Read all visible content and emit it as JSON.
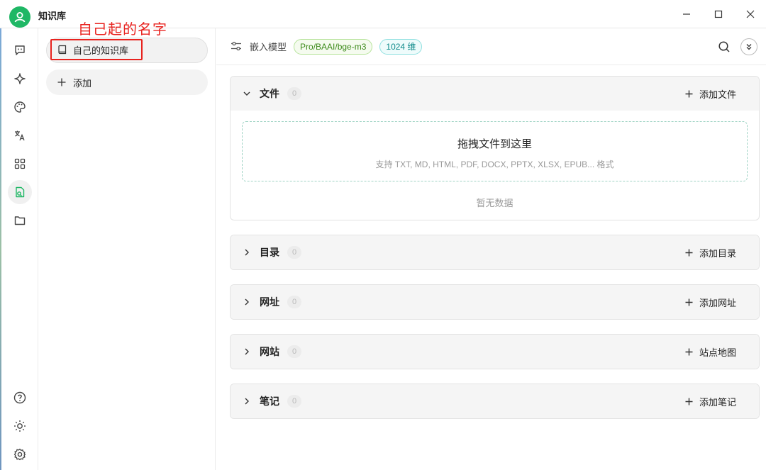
{
  "app": {
    "title": "知识库"
  },
  "annotation": {
    "text": "自己起的名字",
    "color": "#e8231f"
  },
  "rail": {
    "items": [
      {
        "name": "chat-icon"
      },
      {
        "name": "sparkle-icon"
      },
      {
        "name": "palette-icon"
      },
      {
        "name": "translate-icon"
      },
      {
        "name": "apps-icon"
      },
      {
        "name": "knowledge-icon",
        "active": true
      },
      {
        "name": "folder-icon"
      }
    ],
    "bottom": [
      {
        "name": "help-icon"
      },
      {
        "name": "theme-icon"
      },
      {
        "name": "settings-icon"
      }
    ]
  },
  "kb_list": {
    "items": [
      {
        "label": "自己的知识库"
      }
    ],
    "add_label": "添加"
  },
  "header": {
    "embedding_label": "嵌入模型",
    "model_badge": "Pro/BAAI/bge-m3",
    "dim_badge": "1024 维"
  },
  "sections": [
    {
      "title": "文件",
      "count": "0",
      "action": "添加文件",
      "expanded": true,
      "dropzone_title": "拖拽文件到这里",
      "dropzone_sub": "支持 TXT, MD, HTML, PDF, DOCX, PPTX, XLSX, EPUB... 格式",
      "empty_text": "暂无数据"
    },
    {
      "title": "目录",
      "count": "0",
      "action": "添加目录"
    },
    {
      "title": "网址",
      "count": "0",
      "action": "添加网址"
    },
    {
      "title": "网站",
      "count": "0",
      "action": "站点地图"
    },
    {
      "title": "笔记",
      "count": "0",
      "action": "添加笔记"
    }
  ],
  "colors": {
    "accent": "#1fb765",
    "highlight": "#e8231f"
  }
}
